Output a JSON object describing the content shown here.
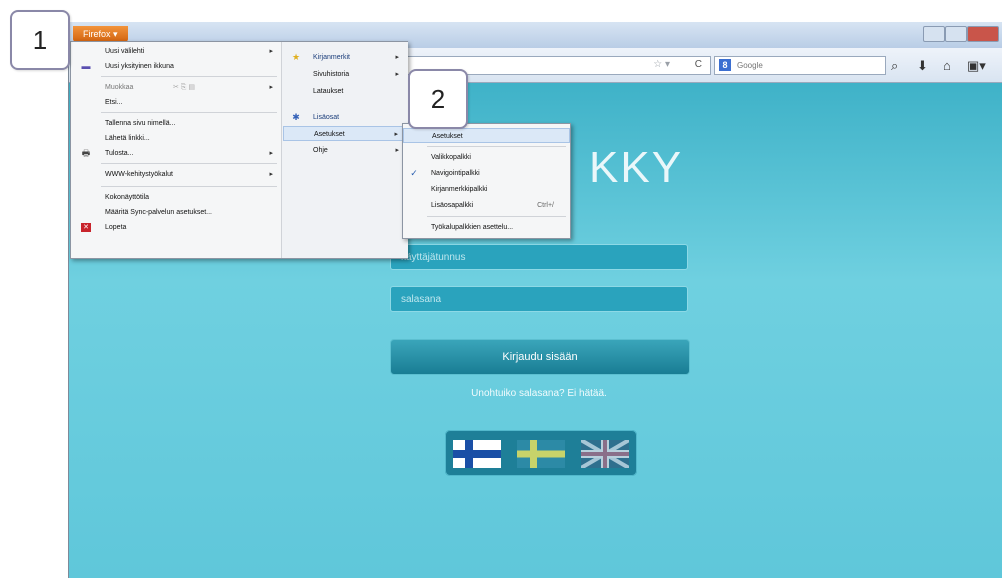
{
  "callouts": {
    "first": "1",
    "second": "2"
  },
  "browser": {
    "app_button": "Firefox ▾",
    "search_placeholder": "Google",
    "search_engine_letter": "8"
  },
  "main_menu": {
    "left_items": [
      {
        "label": "Uusi välilehti"
      },
      {
        "label": "Uusi yksityinen ikkuna"
      },
      {
        "label": "Muokkaa"
      },
      {
        "label": "Etsi..."
      },
      {
        "label": "Tallenna sivu nimellä..."
      },
      {
        "label": "Lähetä linkki..."
      },
      {
        "label": "Tulosta..."
      },
      {
        "label": "WWW-kehitystyökalut"
      },
      {
        "label": "Kokonäyttötila"
      },
      {
        "label": "Määritä Sync-palvelun asetukset..."
      },
      {
        "label": "Lopeta"
      }
    ],
    "right_items": [
      {
        "label": "Kirjanmerkit"
      },
      {
        "label": "Sivuhistoria"
      },
      {
        "label": "Lataukset"
      },
      {
        "label": "Lisäosat"
      },
      {
        "label": "Asetukset"
      },
      {
        "label": "Ohje"
      }
    ]
  },
  "submenu": {
    "items": [
      {
        "label": "Asetukset"
      },
      {
        "label": "Valikkopalkki"
      },
      {
        "label": "Navigointipalkki"
      },
      {
        "label": "Kirjanmerkkipalkki"
      },
      {
        "label": "Lisäosapalkki",
        "shortcut": "Ctrl+/"
      },
      {
        "label": "Työkalupalkkien asettelu..."
      }
    ]
  },
  "page": {
    "logo_text": "KKY",
    "username_placeholder": "käyttäjätunnus",
    "password_placeholder": "salasana",
    "login_button": "Kirjaudu sisään",
    "forgot_link": "Unohtuiko salasana? Ei hätää."
  },
  "colors": {
    "page_bg": "#5ec4d8",
    "app_button": "#e47a22",
    "login_button": "#197d94"
  }
}
